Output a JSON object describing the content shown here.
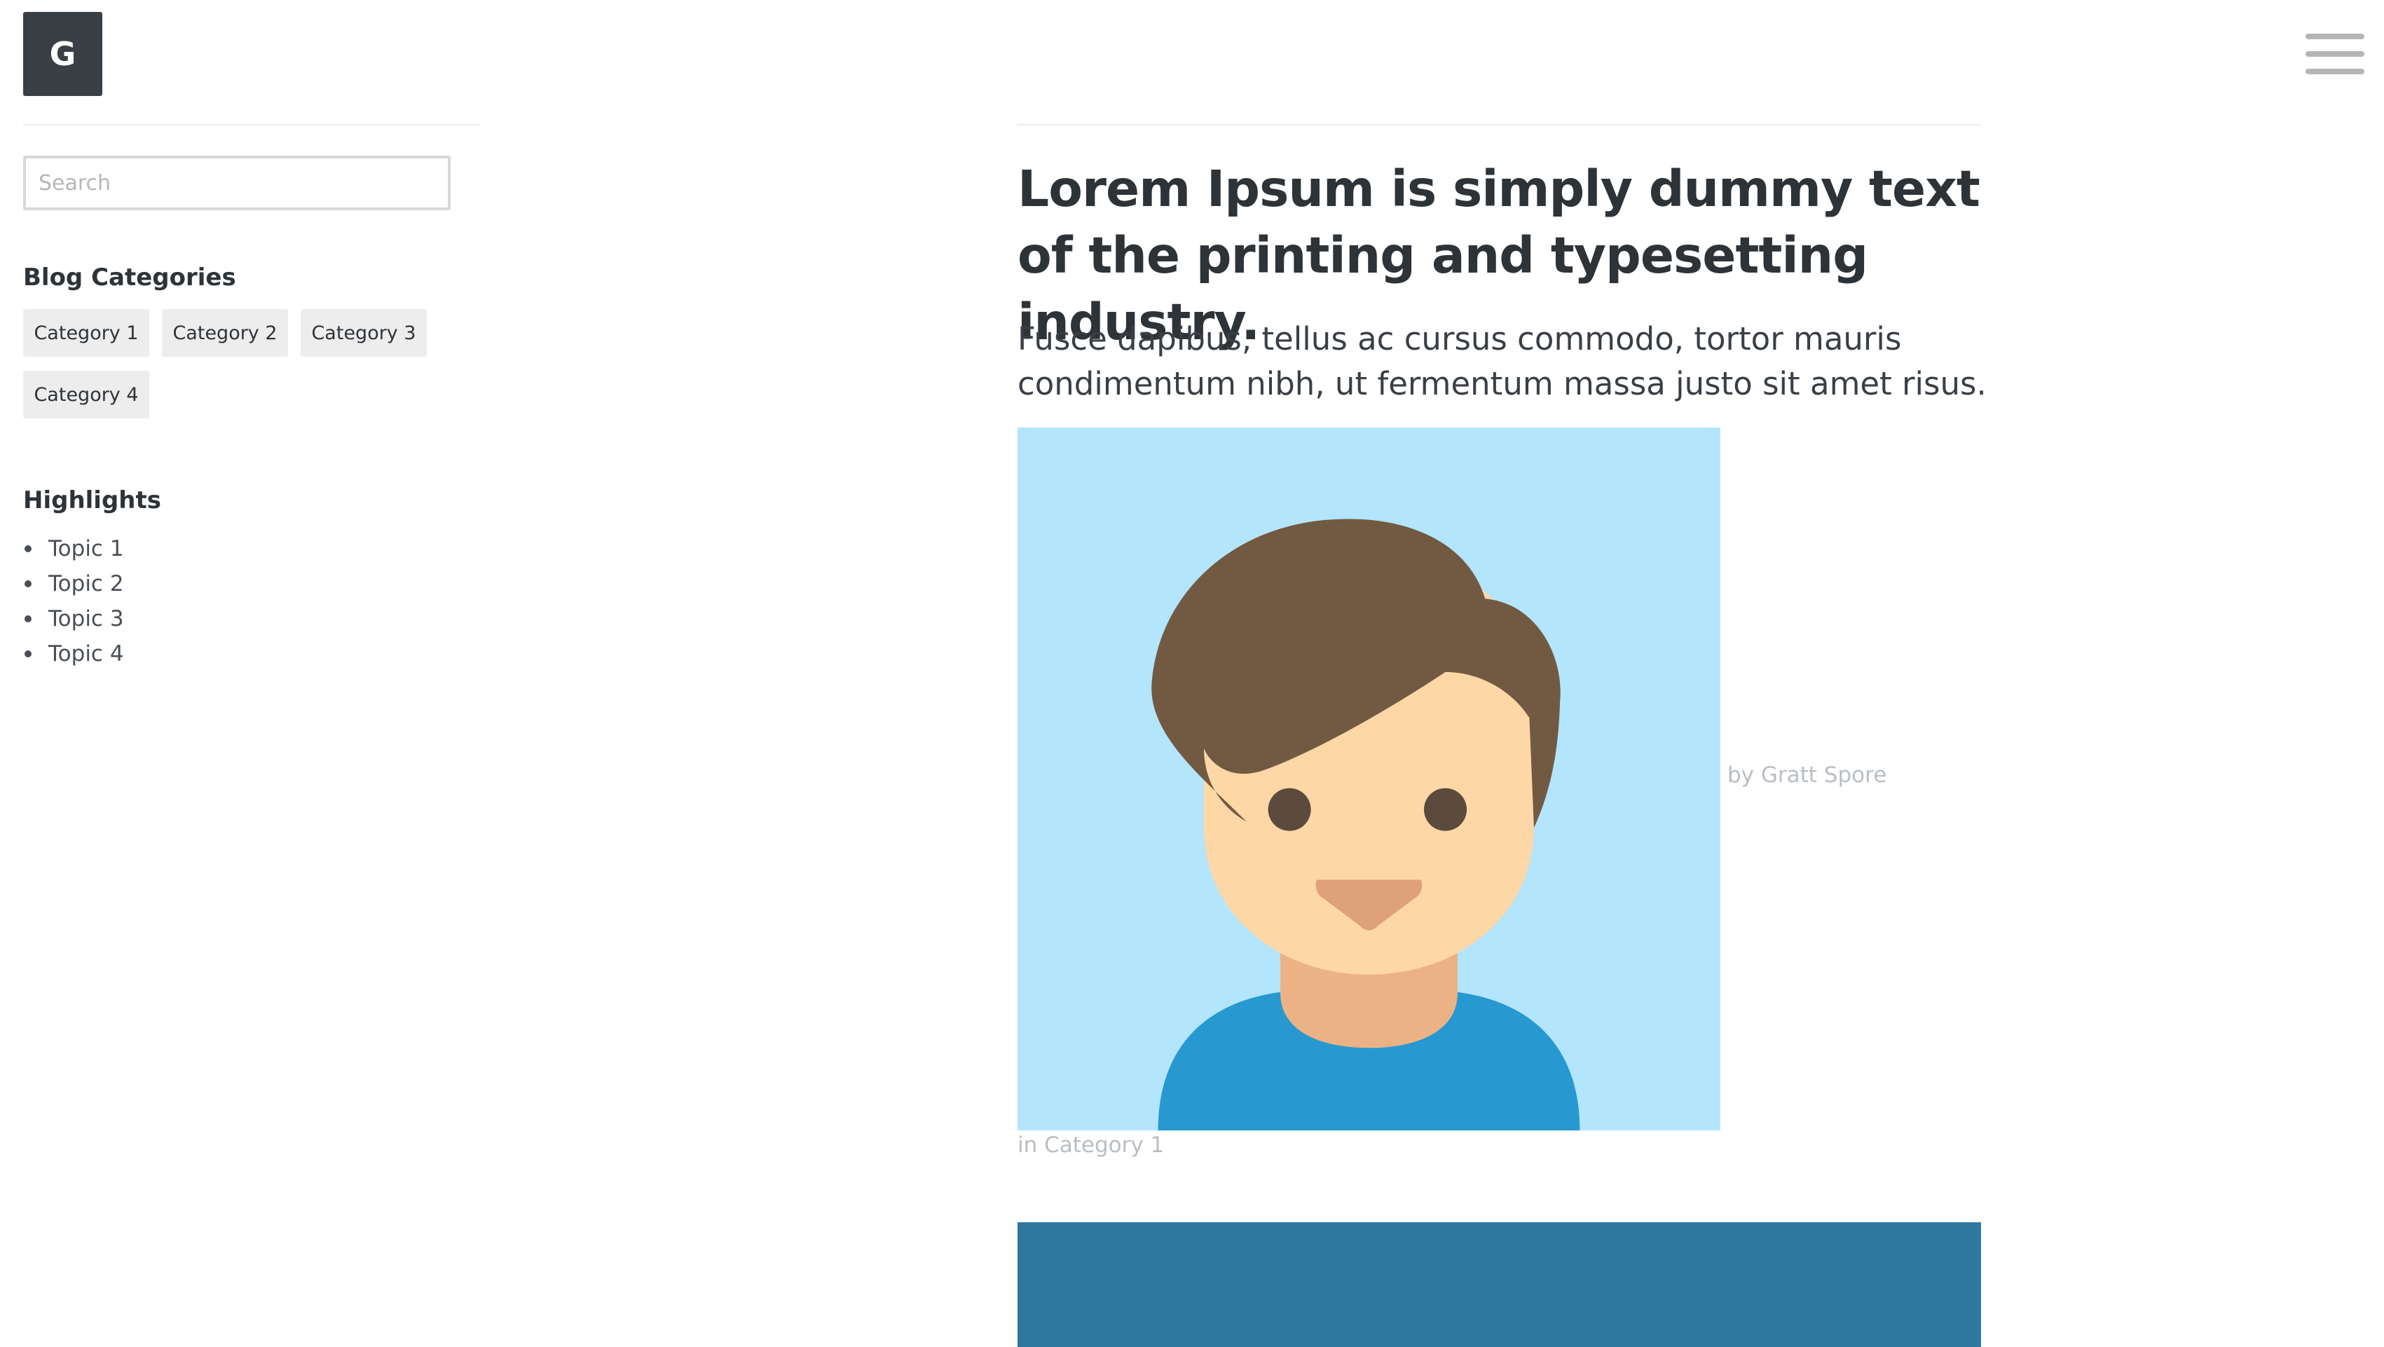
{
  "header": {
    "logo_letter": "G",
    "menu_icon": "hamburger-menu-icon"
  },
  "sidebar": {
    "search": {
      "placeholder": "Search",
      "value": ""
    },
    "categories_heading": "Blog Categories",
    "categories": [
      "Category 1",
      "Category 2",
      "Category 3",
      "Category 4"
    ],
    "highlights_heading": "Highlights",
    "topics": [
      "Topic 1",
      "Topic 2",
      "Topic 3",
      "Topic 4"
    ]
  },
  "article": {
    "title": "Lorem Ipsum is simply dummy text of the printing and typesetting industry.",
    "lead": "Fusce dapibus, tellus ac cursus commodo, tortor mauris condimentum nibh, ut fermentum massa justo sit amet risus.",
    "author_byline": "by Gratt Spore",
    "category_line": "in Category 1",
    "avatar_icon": "user-avatar-icon"
  },
  "colors": {
    "logo_bg": "#3a3f46",
    "tag_bg": "#ededed",
    "muted_text": "#b9bec4",
    "avatar_bg": "#b3e5fc",
    "feature_block": "#2e789e"
  }
}
